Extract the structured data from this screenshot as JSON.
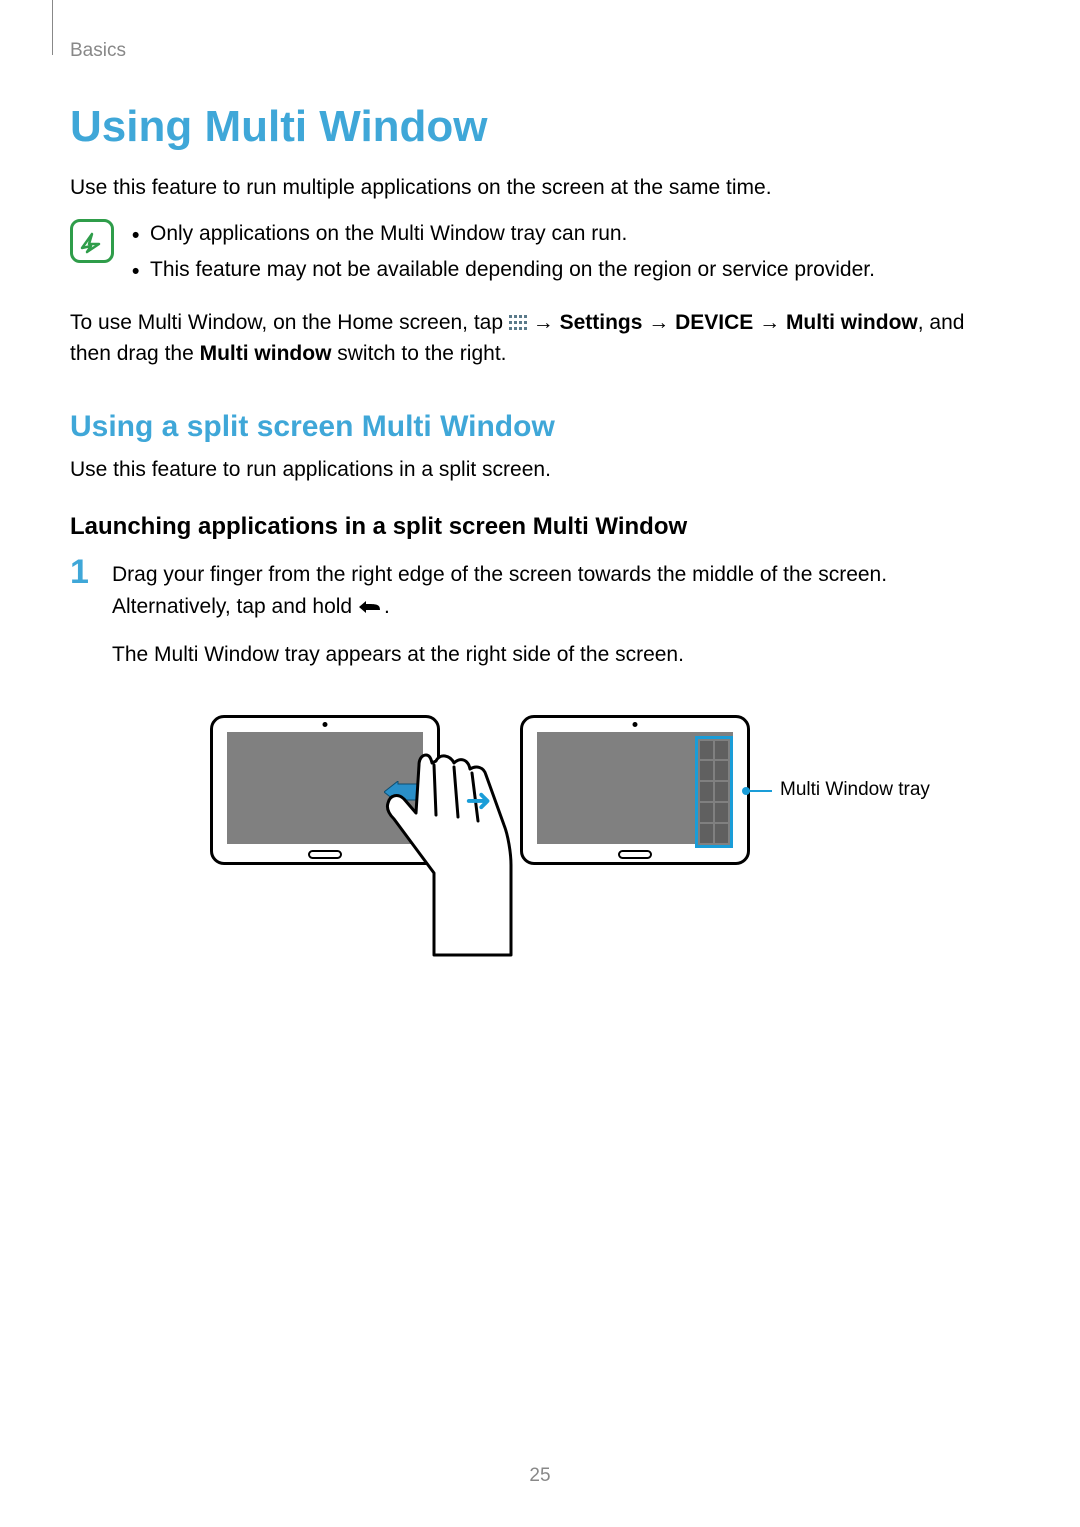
{
  "breadcrumb": "Basics",
  "h1": "Using Multi Window",
  "intro": "Use this feature to run multiple applications on the screen at the same time.",
  "notes": {
    "n1": "Only applications on the Multi Window tray can run.",
    "n2": "This feature may not be available depending on the region or service provider."
  },
  "enable": {
    "pre": "To use Multi Window, on the Home screen, tap ",
    "arrow1": " → ",
    "settings": "Settings",
    "arrow2": " → ",
    "device": "DEVICE",
    "arrow3": " → ",
    "mw1": "Multi window",
    "mid": ", and then drag the ",
    "mw2": "Multi window",
    "post": " switch to the right."
  },
  "h2": "Using a split screen Multi Window",
  "h2_desc": "Use this feature to run applications in a split screen.",
  "h3": "Launching applications in a split screen Multi Window",
  "step1": {
    "num": "1",
    "line1a": "Drag your finger from the right edge of the screen towards the middle of the screen. Alternatively, tap and hold ",
    "line1b": ".",
    "line2": "The Multi Window tray appears at the right side of the screen."
  },
  "callout": "Multi Window tray",
  "page_number": "25"
}
